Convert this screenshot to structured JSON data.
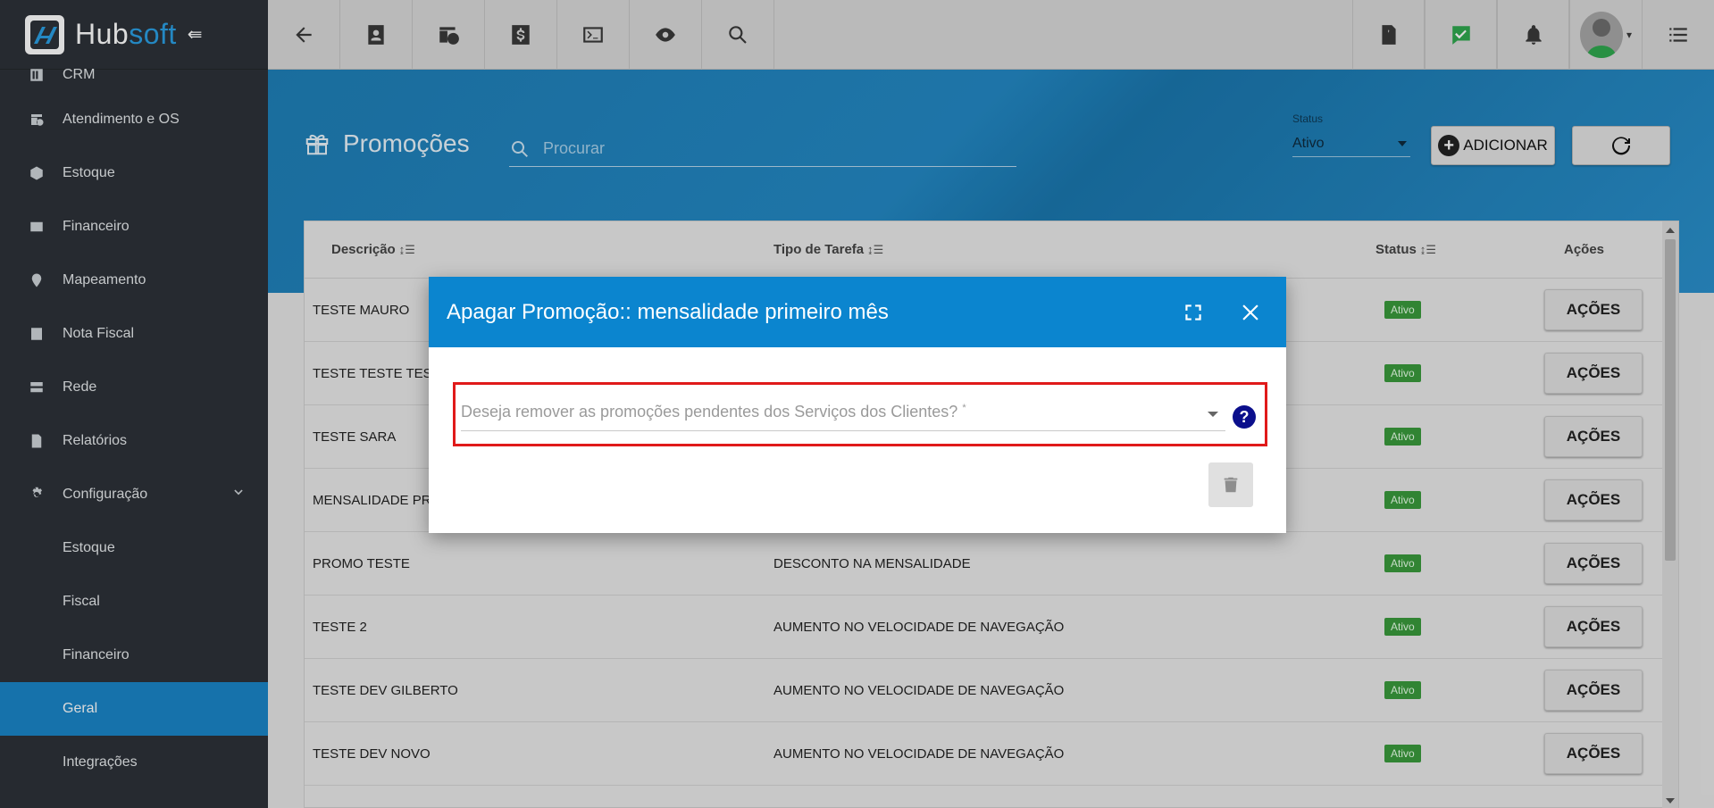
{
  "brand": {
    "name_part1": "Hub",
    "name_part2": "soft"
  },
  "sidebar": {
    "items": [
      {
        "label": "CRM",
        "icon": "crm-icon"
      },
      {
        "label": "Atendimento e OS",
        "icon": "calendar-clock-icon"
      },
      {
        "label": "Estoque",
        "icon": "box-icon"
      },
      {
        "label": "Financeiro",
        "icon": "money-icon"
      },
      {
        "label": "Mapeamento",
        "icon": "map-pin-icon"
      },
      {
        "label": "Nota Fiscal",
        "icon": "invoice-icon"
      },
      {
        "label": "Rede",
        "icon": "server-icon"
      },
      {
        "label": "Relatórios",
        "icon": "report-icon"
      },
      {
        "label": "Configuração",
        "icon": "gear-icon"
      }
    ],
    "subitems": [
      "Estoque",
      "Fiscal",
      "Financeiro",
      "Geral",
      "Integrações"
    ],
    "active": "Geral"
  },
  "topbar": {
    "buttons": [
      "back-icon",
      "contact-icon",
      "schedule-icon",
      "dollar-icon",
      "terminal-icon",
      "eye-icon",
      "search-icon"
    ],
    "right_buttons": [
      "pdf-icon",
      "check-icon",
      "bell-icon",
      "avatar",
      "list-icon"
    ]
  },
  "page": {
    "title": "Promoções",
    "search_placeholder": "Procurar",
    "status_label": "Status",
    "status_value": "Ativo",
    "add_label": "ADICIONAR"
  },
  "table": {
    "headers": {
      "descricao": "Descrição",
      "tipo": "Tipo de Tarefa",
      "status": "Status",
      "acoes": "Ações"
    },
    "rows": [
      {
        "descricao": "TESTE MAURO",
        "tipo": "",
        "status": "Ativo",
        "acoes": "AÇÕES"
      },
      {
        "descricao": "TESTE TESTE TES",
        "tipo": "",
        "status": "Ativo",
        "acoes": "AÇÕES"
      },
      {
        "descricao": "TESTE SARA",
        "tipo": "",
        "status": "Ativo",
        "acoes": "AÇÕES"
      },
      {
        "descricao": "MENSALIDADE PR",
        "tipo": "",
        "status": "Ativo",
        "acoes": "AÇÕES"
      },
      {
        "descricao": "PROMO TESTE",
        "tipo": "DESCONTO NA MENSALIDADE",
        "status": "Ativo",
        "acoes": "AÇÕES"
      },
      {
        "descricao": "TESTE 2",
        "tipo": "AUMENTO NO VELOCIDADE DE NAVEGAÇÃO",
        "status": "Ativo",
        "acoes": "AÇÕES"
      },
      {
        "descricao": "TESTE DEV GILBERTO",
        "tipo": "AUMENTO NO VELOCIDADE DE NAVEGAÇÃO",
        "status": "Ativo",
        "acoes": "AÇÕES"
      },
      {
        "descricao": "TESTE DEV NOVO",
        "tipo": "AUMENTO NO VELOCIDADE DE NAVEGAÇÃO",
        "status": "Ativo",
        "acoes": "AÇÕES"
      }
    ]
  },
  "modal": {
    "title": "Apagar Promoção:: mensalidade primeiro mês",
    "field_label": "Deseja remover as promoções pendentes dos Serviços dos Clientes?",
    "required_mark": "*",
    "help": "?"
  },
  "colors": {
    "accent": "#0b85cf",
    "sidebar_bg": "#2d3238",
    "active_item": "#1a85c8",
    "badge": "#3a9a3c",
    "highlight_border": "#e01a1a"
  }
}
